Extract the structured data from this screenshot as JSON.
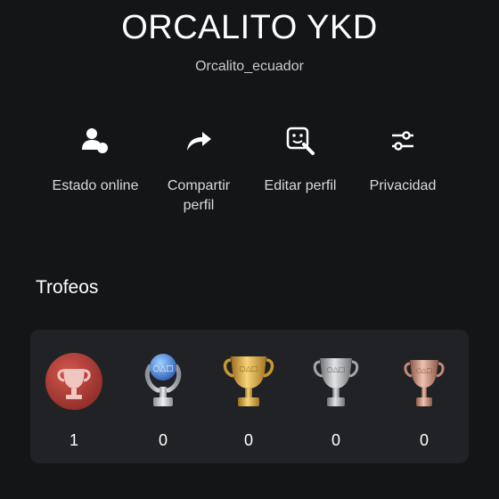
{
  "profile": {
    "display_name": "ORCALITO YKD",
    "online_id": "Orcalito_ecuador"
  },
  "actions": [
    {
      "label": "Estado online",
      "icon": "user-status-icon"
    },
    {
      "label": "Compartir perfil",
      "icon": "share-arrow-icon"
    },
    {
      "label": "Editar perfil",
      "icon": "edit-profile-icon"
    },
    {
      "label": "Privacidad",
      "icon": "sliders-icon"
    }
  ],
  "trophies": {
    "title": "Trofeos",
    "items": [
      {
        "kind": "level",
        "icon": "trophy-level-icon",
        "value": "1"
      },
      {
        "kind": "platinum",
        "icon": "platinum-trophy-icon",
        "value": "0"
      },
      {
        "kind": "gold",
        "icon": "gold-trophy-icon",
        "value": "0"
      },
      {
        "kind": "silver",
        "icon": "silver-trophy-icon",
        "value": "0"
      },
      {
        "kind": "bronze",
        "icon": "bronze-trophy-icon",
        "value": "0"
      }
    ]
  },
  "colors": {
    "background": "#131517",
    "card": "#202225",
    "level": "#b5443c",
    "platinum": "#5a8fe0",
    "gold": "#d9a53a",
    "silver": "#a9abad",
    "bronze": "#c98a78"
  }
}
